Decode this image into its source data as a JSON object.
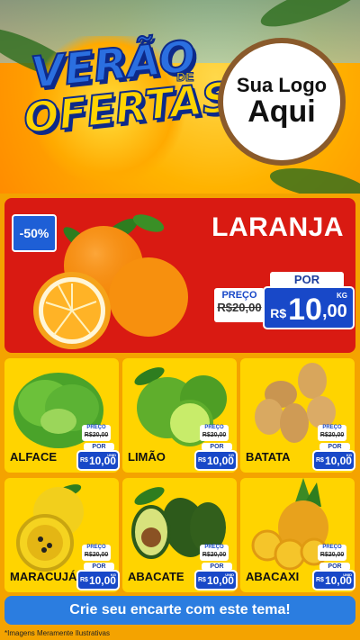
{
  "header": {
    "title_line1": "VERÃO",
    "title_de": "DE",
    "title_line2": "OFERTAS",
    "logo_line1": "Sua Logo",
    "logo_line2": "Aqui"
  },
  "hero": {
    "discount": "-50%",
    "name": "LARANJA",
    "preco_label": "PREÇO",
    "old_price": "R$20,00",
    "por_label": "POR",
    "currency": "R$",
    "price_int": "10",
    "price_dec": ",00",
    "unit": "KG"
  },
  "products": [
    {
      "name": "ALFACE",
      "preco_label": "PREÇO",
      "old_price": "R$20,00",
      "por_label": "POR",
      "currency": "R$",
      "price": "10,00",
      "unit": "UNID"
    },
    {
      "name": "LIMÃO",
      "preco_label": "PREÇO",
      "old_price": "R$20,00",
      "por_label": "POR",
      "currency": "R$",
      "price": "10,00",
      "unit": "KG"
    },
    {
      "name": "BATATA",
      "preco_label": "PREÇO",
      "old_price": "R$20,00",
      "por_label": "POR",
      "currency": "R$",
      "price": "10,00",
      "unit": "KG"
    },
    {
      "name": "MARACUJÁ",
      "preco_label": "PREÇO",
      "old_price": "R$20,00",
      "por_label": "POR",
      "currency": "R$",
      "price": "10,00",
      "unit": "KG"
    },
    {
      "name": "ABACATE",
      "preco_label": "PREÇO",
      "old_price": "R$20,00",
      "por_label": "POR",
      "currency": "R$",
      "price": "10,00",
      "unit": "UNID"
    },
    {
      "name": "ABACAXI",
      "preco_label": "PREÇO",
      "old_price": "R$20,00",
      "por_label": "POR",
      "currency": "R$",
      "price": "10,00",
      "unit": "UNID"
    }
  ],
  "cta": {
    "label": "Crie seu encarte com este tema!"
  },
  "footer": {
    "disclaimer": "*Imagens Meramente Ilustrativas"
  },
  "colors": {
    "hero_bg": "#d91a12",
    "card_bg": "#ffd400",
    "price_blue": "#1848c8",
    "cta_blue": "#2b7de0"
  }
}
